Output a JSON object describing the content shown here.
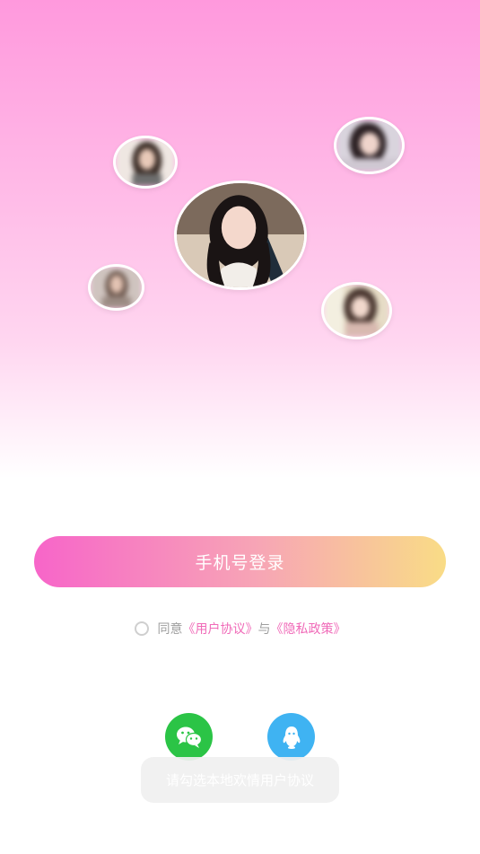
{
  "avatars": {
    "main": "main-avatar",
    "others": [
      "avatar-1",
      "avatar-2",
      "avatar-3",
      "avatar-4"
    ]
  },
  "login": {
    "phone_login_label": "手机号登录"
  },
  "agreement": {
    "prefix": "同意",
    "user_agreement": "《用户协议》",
    "conjunction": "与",
    "privacy_policy": "《隐私政策》",
    "checked": false
  },
  "social": {
    "wechat_icon": "wechat-icon",
    "qq_icon": "qq-icon"
  },
  "toast": {
    "message": "请勾选本地欢情用户协议"
  },
  "colors": {
    "accent_pink": "#f06ab8",
    "wechat_green": "#2bc446",
    "qq_blue": "#3fb3f2",
    "gradient_start": "#f765c9",
    "gradient_end": "#f9dc86"
  }
}
